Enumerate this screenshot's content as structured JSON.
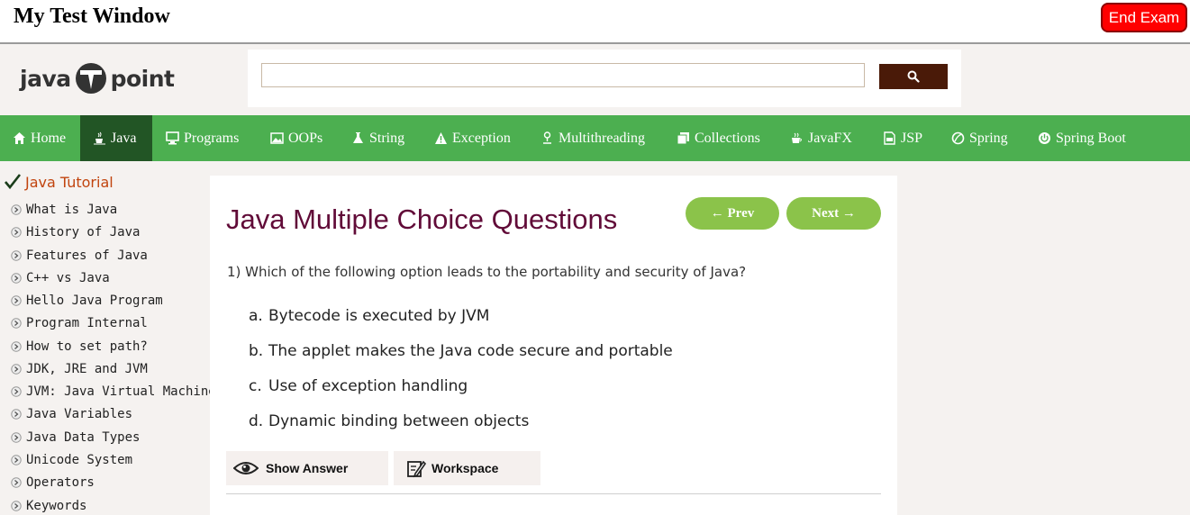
{
  "window": {
    "title": "My Test Window",
    "end_exam_label": "End Exam"
  },
  "header": {
    "logo_left": "java",
    "logo_right": "point",
    "search_placeholder": "",
    "search_icon": "search-icon"
  },
  "nav": {
    "items": [
      {
        "label": "Home",
        "icon": "home-icon"
      },
      {
        "label": "Java",
        "icon": "java-cup-icon",
        "active": true
      },
      {
        "label": "Programs",
        "icon": "monitor-icon"
      },
      {
        "label": "OOPs",
        "icon": "image-icon"
      },
      {
        "label": "String",
        "icon": "flask-icon"
      },
      {
        "label": "Exception",
        "icon": "warning-icon"
      },
      {
        "label": "Multithreading",
        "icon": "person-icon"
      },
      {
        "label": "Collections",
        "icon": "copy-icon"
      },
      {
        "label": "JavaFX",
        "icon": "coffee-icon"
      },
      {
        "label": "JSP",
        "icon": "file-icon"
      },
      {
        "label": "Spring",
        "icon": "leaf-icon"
      },
      {
        "label": "Spring Boot",
        "icon": "power-icon"
      }
    ]
  },
  "sidebar": {
    "heading": "Java Tutorial",
    "items": [
      "What is Java",
      "History of Java",
      "Features of Java",
      "C++ vs Java",
      "Hello Java Program",
      "Program Internal",
      "How to set path?",
      "JDK, JRE and JVM",
      "JVM: Java Virtual Machine",
      "Java Variables",
      "Java Data Types",
      "Unicode System",
      "Operators",
      "Keywords"
    ]
  },
  "main": {
    "title": "Java Multiple Choice Questions",
    "prev_label": "← Prev",
    "next_label": "Next →",
    "question": "1) Which of the following option leads to the portability and security of Java?",
    "options": [
      {
        "letter": "a.",
        "text": "Bytecode is executed by JVM"
      },
      {
        "letter": "b.",
        "text": "The applet makes the Java code secure and portable"
      },
      {
        "letter": "c.",
        "text": "Use of exception handling"
      },
      {
        "letter": "d.",
        "text": "Dynamic binding between objects"
      }
    ],
    "show_answer_label": "Show Answer",
    "workspace_label": "Workspace"
  },
  "colors": {
    "nav_bg": "#4caf50",
    "nav_active": "#225525",
    "title": "#610b38",
    "button_green": "#8bc34a",
    "end_exam": "#ff0000",
    "sidebar_heading": "#c1440e"
  }
}
